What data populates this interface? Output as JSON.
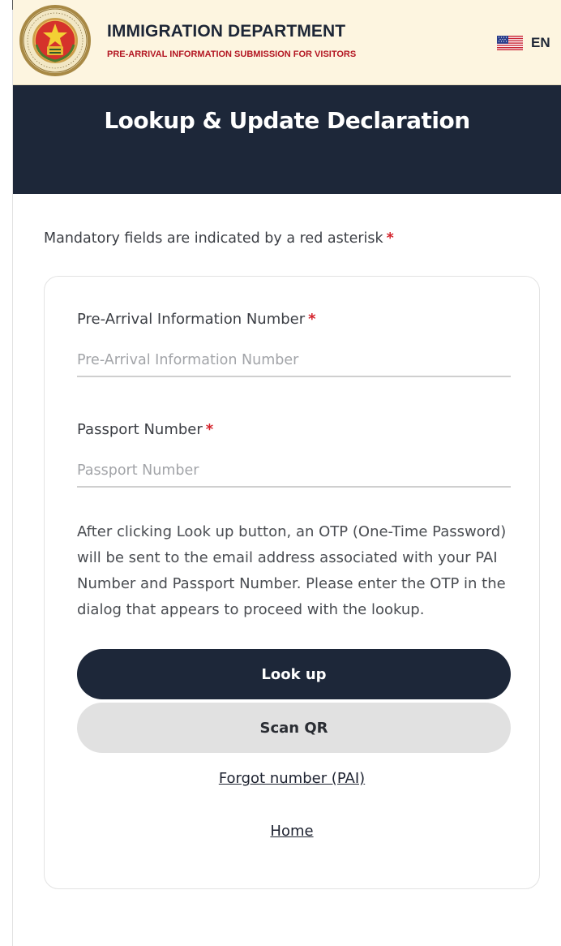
{
  "header": {
    "org_name": "IMMIGRATION DEPARTMENT",
    "tagline": "PRE-ARRIVAL INFORMATION SUBMISSION FOR VISITORS",
    "logo_icon": "immigration-emblem-icon",
    "language": {
      "code": "EN",
      "flag_icon": "us-flag-icon"
    }
  },
  "banner": {
    "title": "Lookup & Update Declaration"
  },
  "form": {
    "mandatory_note": "Mandatory fields are indicated by a red asterisk",
    "required_mark": "*",
    "pai_number": {
      "label": "Pre-Arrival Information Number",
      "placeholder": "Pre-Arrival Information Number",
      "value": ""
    },
    "passport_number": {
      "label": "Passport Number",
      "placeholder": "Passport Number",
      "value": ""
    },
    "info": "After clicking Look up button, an OTP (One-Time Password) will be sent to the email address associated with your PAI Number and Passport Number. Please enter the OTP in the dialog that appears to proceed with the lookup.",
    "lookup_label": "Look up",
    "scan_qr_label": "Scan QR",
    "forgot_link": "Forgot number (PAI)",
    "home_link": "Home"
  },
  "colors": {
    "header_bg": "#fdf5e0",
    "navy": "#1d2739",
    "required_red": "#d4232c",
    "tagline_red": "#b31622",
    "secondary_button": "#e1e1e1"
  }
}
